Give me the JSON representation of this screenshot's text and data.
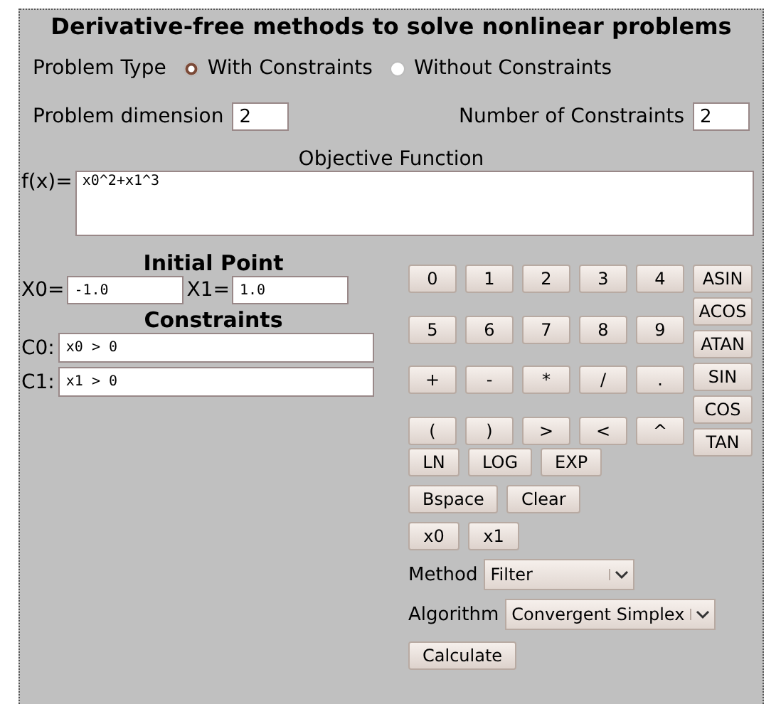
{
  "title": "Derivative-free methods to solve nonlinear problems",
  "problem_type": {
    "label": "Problem Type",
    "options": [
      {
        "label": "With Constraints",
        "selected": true
      },
      {
        "label": "Without Constraints",
        "selected": false
      }
    ]
  },
  "dimension": {
    "label": "Problem dimension",
    "value": "2"
  },
  "constraint_count": {
    "label": "Number of Constraints",
    "value": "2"
  },
  "objective": {
    "heading": "Objective Function",
    "label": "f(x)=",
    "value": "x0^2+x1^3"
  },
  "initial_point": {
    "heading": "Initial Point",
    "fields": [
      {
        "label": "X0=",
        "value": "-1.0"
      },
      {
        "label": "X1=",
        "value": "1.0"
      }
    ]
  },
  "constraints": {
    "heading": "Constraints",
    "fields": [
      {
        "label": "C0:",
        "value": "x0 > 0"
      },
      {
        "label": "C1:",
        "value": "x1 > 0"
      }
    ]
  },
  "keypad": [
    [
      "0",
      "1",
      "2",
      "3",
      "4"
    ],
    [
      "5",
      "6",
      "7",
      "8",
      "9"
    ],
    [
      "+",
      "-",
      "*",
      "/",
      "."
    ],
    [
      "(",
      ")",
      ">",
      "<",
      "^"
    ]
  ],
  "function_keys": [
    "ASIN",
    "ACOS",
    "ATAN",
    "SIN",
    "COS",
    "TAN"
  ],
  "key_rows": [
    [
      "LN",
      "LOG",
      "EXP"
    ],
    [
      "Bspace",
      "Clear"
    ],
    [
      "x0",
      "x1"
    ]
  ],
  "method": {
    "label": "Method",
    "value": "Filter"
  },
  "algorithm": {
    "label": "Algorithm",
    "value": "Convergent Simplex"
  },
  "calculate": "Calculate"
}
